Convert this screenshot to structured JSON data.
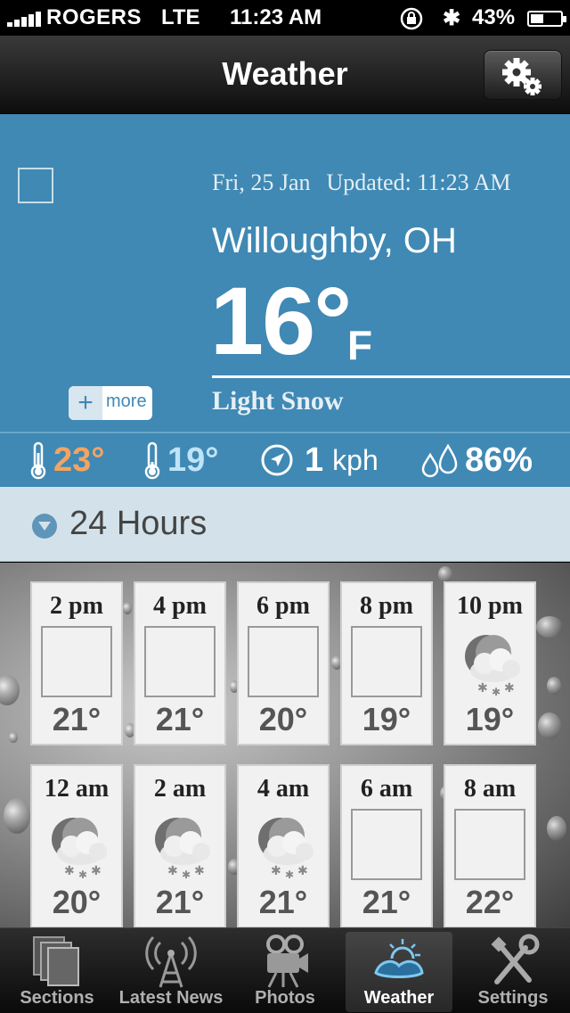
{
  "status_bar": {
    "carrier": "ROGERS",
    "network": "LTE",
    "time": "11:23 AM",
    "battery_percent": "43%",
    "battery_level": 0.43
  },
  "nav": {
    "title": "Weather",
    "settings_icon": "gears-icon"
  },
  "current": {
    "date": "Fri, 25 Jan",
    "updated": "Updated: 11:23 AM",
    "location": "Willoughby, OH",
    "temperature": "16°",
    "unit": "F",
    "condition": "Light Snow",
    "more_label": "more",
    "more_plus": "+"
  },
  "stats": {
    "high": "23°",
    "low": "19°",
    "wind_value": "1",
    "wind_unit": "kph",
    "humidity": "86%"
  },
  "hours_section": {
    "label": "24 Hours"
  },
  "hourly": [
    {
      "time": "2 pm",
      "temp": "21°",
      "icon": "none"
    },
    {
      "time": "4 pm",
      "temp": "21°",
      "icon": "none"
    },
    {
      "time": "6 pm",
      "temp": "20°",
      "icon": "none"
    },
    {
      "time": "8 pm",
      "temp": "19°",
      "icon": "none"
    },
    {
      "time": "10 pm",
      "temp": "19°",
      "icon": "night-snow-icon"
    },
    {
      "time": "12 am",
      "temp": "20°",
      "icon": "night-snow-icon"
    },
    {
      "time": "2 am",
      "temp": "21°",
      "icon": "night-snow-icon"
    },
    {
      "time": "4 am",
      "temp": "21°",
      "icon": "night-snow-icon"
    },
    {
      "time": "6 am",
      "temp": "21°",
      "icon": "none"
    },
    {
      "time": "8 am",
      "temp": "22°",
      "icon": "none"
    }
  ],
  "tabs": [
    {
      "label": "Sections",
      "icon": "sections-icon",
      "active": false
    },
    {
      "label": "Latest News",
      "icon": "antenna-icon",
      "active": false
    },
    {
      "label": "Photos",
      "icon": "camera-icon",
      "active": false
    },
    {
      "label": "Weather",
      "icon": "weather-icon",
      "active": true
    },
    {
      "label": "Settings",
      "icon": "tools-icon",
      "active": false
    }
  ],
  "colors": {
    "panel_blue": "#3f89b4",
    "high_temp": "#f4a460",
    "low_temp": "#bfe3f7"
  }
}
